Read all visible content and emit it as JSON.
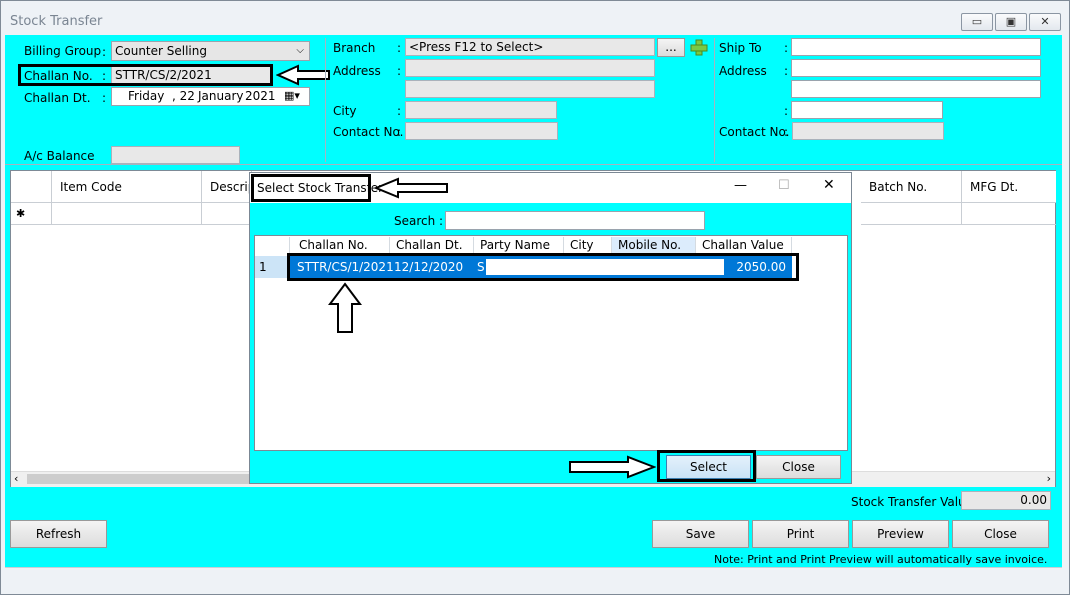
{
  "window": {
    "title": "Stock Transfer",
    "min_icon": "minimize-icon",
    "max_icon": "maximize-icon",
    "close_icon": "close-icon"
  },
  "form": {
    "billing_group_label": "Billing Group",
    "billing_group_value": "Counter Selling",
    "challan_no_label": "Challan No.",
    "challan_no_value": "STTR/CS/2/2021",
    "challan_dt_label": "Challan Dt.",
    "challan_dt_day": "Friday",
    "challan_dt_date": ", 22",
    "challan_dt_month": "January",
    "challan_dt_year": "2021",
    "ac_balance_label": "A/c Balance",
    "ac_balance_value": "",
    "branch_label": "Branch",
    "branch_value": "<Press F12 to Select>",
    "branch_button": "...",
    "address_label": "Address",
    "city_label": "City",
    "contact_no_label": "Contact No.",
    "ship_to_label": "Ship To",
    "ship_address_label": "Address",
    "ship_contact_label": "Contact No.",
    "colon": ":"
  },
  "grid": {
    "columns": [
      "Item Code",
      "Descripti",
      "Batch No.",
      "MFG Dt."
    ],
    "new_row_marker": "✱"
  },
  "dialog": {
    "title": "Select Stock Transfer",
    "search_label": "Search :",
    "columns": [
      "Challan No.",
      "Challan Dt.",
      "Party Name",
      "City",
      "Mobile No.",
      "Challan Value"
    ],
    "rows": [
      {
        "index": "1",
        "challan_no": "STTR/CS/1/2021",
        "challan_dt": "12/12/2020",
        "party_name": "S",
        "city": "",
        "mobile": "",
        "challan_value": "2050.00"
      }
    ],
    "select_button": "Select",
    "close_button": "Close",
    "minimize_icon": "minimize-icon",
    "maximize_icon": "maximize-icon",
    "close_icon": "close-icon"
  },
  "footer": {
    "stock_transfer_value_label": "Stock Transfer Value :",
    "stock_transfer_value": "0.00",
    "refresh_button": "Refresh",
    "save_button": "Save",
    "print_button": "Print",
    "preview_button": "Preview",
    "close_button": "Close",
    "note": "Note: Print and Print Preview will automatically save invoice."
  }
}
